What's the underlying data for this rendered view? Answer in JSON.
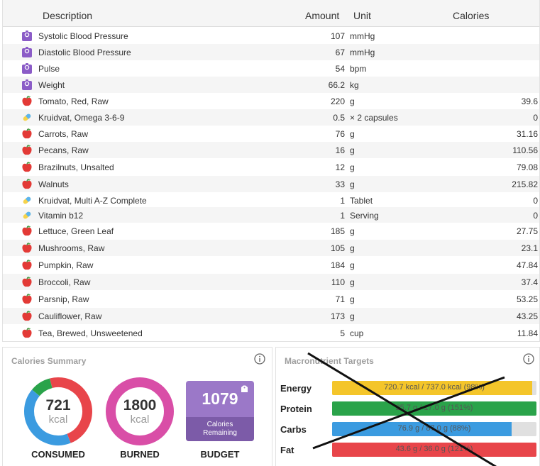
{
  "table": {
    "headers": {
      "description": "Description",
      "amount": "Amount",
      "unit": "Unit",
      "calories": "Calories"
    },
    "rows": [
      {
        "icon": "biometric-icon",
        "description": "Systolic Blood Pressure",
        "amount": "107",
        "unit": "mmHg",
        "calories": ""
      },
      {
        "icon": "biometric-icon",
        "description": "Diastolic Blood Pressure",
        "amount": "67",
        "unit": "mmHg",
        "calories": ""
      },
      {
        "icon": "biometric-icon",
        "description": "Pulse",
        "amount": "54",
        "unit": "bpm",
        "calories": ""
      },
      {
        "icon": "biometric-icon",
        "description": "Weight",
        "amount": "66.2",
        "unit": "kg",
        "calories": ""
      },
      {
        "icon": "food-apple-icon",
        "description": "Tomato, Red, Raw",
        "amount": "220",
        "unit": "g",
        "calories": "39.6"
      },
      {
        "icon": "supplement-pill-icon",
        "description": "Kruidvat, Omega 3-6-9",
        "amount": "0.5",
        "unit": "× 2 capsules",
        "calories": "0"
      },
      {
        "icon": "food-apple-icon",
        "description": "Carrots, Raw",
        "amount": "76",
        "unit": "g",
        "calories": "31.16"
      },
      {
        "icon": "food-apple-icon",
        "description": "Pecans, Raw",
        "amount": "16",
        "unit": "g",
        "calories": "110.56"
      },
      {
        "icon": "food-apple-icon",
        "description": "Brazilnuts, Unsalted",
        "amount": "12",
        "unit": "g",
        "calories": "79.08"
      },
      {
        "icon": "food-apple-icon",
        "description": "Walnuts",
        "amount": "33",
        "unit": "g",
        "calories": "215.82"
      },
      {
        "icon": "supplement-pill-icon",
        "description": "Kruidvat, Multi A-Z Complete",
        "amount": "1",
        "unit": "Tablet",
        "calories": "0"
      },
      {
        "icon": "supplement-pill-icon",
        "description": "Vitamin b12",
        "amount": "1",
        "unit": "Serving",
        "calories": "0"
      },
      {
        "icon": "food-apple-icon",
        "description": "Lettuce, Green Leaf",
        "amount": "185",
        "unit": "g",
        "calories": "27.75"
      },
      {
        "icon": "food-apple-icon",
        "description": "Mushrooms, Raw",
        "amount": "105",
        "unit": "g",
        "calories": "23.1"
      },
      {
        "icon": "food-apple-icon",
        "description": "Pumpkin, Raw",
        "amount": "184",
        "unit": "g",
        "calories": "47.84"
      },
      {
        "icon": "food-apple-icon",
        "description": "Broccoli, Raw",
        "amount": "110",
        "unit": "g",
        "calories": "37.4"
      },
      {
        "icon": "food-apple-icon",
        "description": "Parsnip, Raw",
        "amount": "71",
        "unit": "g",
        "calories": "53.25"
      },
      {
        "icon": "food-apple-icon",
        "description": "Cauliflower, Raw",
        "amount": "173",
        "unit": "g",
        "calories": "43.25"
      },
      {
        "icon": "food-apple-icon",
        "description": "Tea, Brewed, Unsweetened",
        "amount": "5",
        "unit": "cup",
        "calories": "11.84"
      }
    ]
  },
  "calories_summary": {
    "title": "Calories Summary",
    "info_icon": "info-icon",
    "consumed": {
      "value": "721",
      "unit": "kcal",
      "label": "CONSUMED",
      "segments": [
        {
          "color": "#e8454a",
          "fraction": 0.48
        },
        {
          "color": "#3b9be0",
          "fraction": 0.42
        },
        {
          "color": "#2aa34a",
          "fraction": 0.1
        }
      ]
    },
    "burned": {
      "value": "1800",
      "unit": "kcal",
      "label": "BURNED",
      "color": "#d94ea7"
    },
    "budget": {
      "value": "1079",
      "sub1": "Calories",
      "sub2": "Remaining",
      "label": "BUDGET",
      "color": "#9b78c8"
    }
  },
  "macronutrient_targets": {
    "title": "Macronutrient Targets",
    "info_icon": "info-icon",
    "crossed_out": true,
    "rows": [
      {
        "name": "Energy",
        "text": "720.7 kcal / 737.0 kcal (98%)",
        "fraction": 0.98,
        "color": "#f4c52a"
      },
      {
        "name": "Protein",
        "text": "25.7 g / 17.0 g (151%)",
        "fraction": 1.0,
        "color": "#2aa34a"
      },
      {
        "name": "Carbs",
        "text": "76.9 g / 87.0 g (88%)",
        "fraction": 0.88,
        "color": "#3b9be0"
      },
      {
        "name": "Fat",
        "text": "43.6 g / 36.0 g (121%)",
        "fraction": 1.0,
        "color": "#e8454a"
      }
    ]
  }
}
